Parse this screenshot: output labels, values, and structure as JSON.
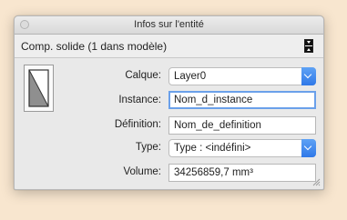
{
  "window": {
    "title": "Infos sur l'entité"
  },
  "header": {
    "label": "Comp. solide (1 dans modèle)",
    "toggle_icon": "expand-collapse-icon"
  },
  "thumbnail": {
    "icon": "component-thumbnail-icon"
  },
  "fields": {
    "calque": {
      "label": "Calque:",
      "value": "Layer0"
    },
    "instance": {
      "label": "Instance:",
      "value": "Nom_d_instance"
    },
    "definition": {
      "label": "Définition:",
      "value": "Nom_de_definition"
    },
    "type": {
      "label": "Type:",
      "value": "Type : <indéfini>"
    },
    "volume": {
      "label": "Volume:",
      "value": "34256859,7 mm³"
    }
  },
  "colors": {
    "accent": "#2f78e8",
    "focus_ring": "#6aa0ea",
    "desktop": "#f8e6cf"
  }
}
